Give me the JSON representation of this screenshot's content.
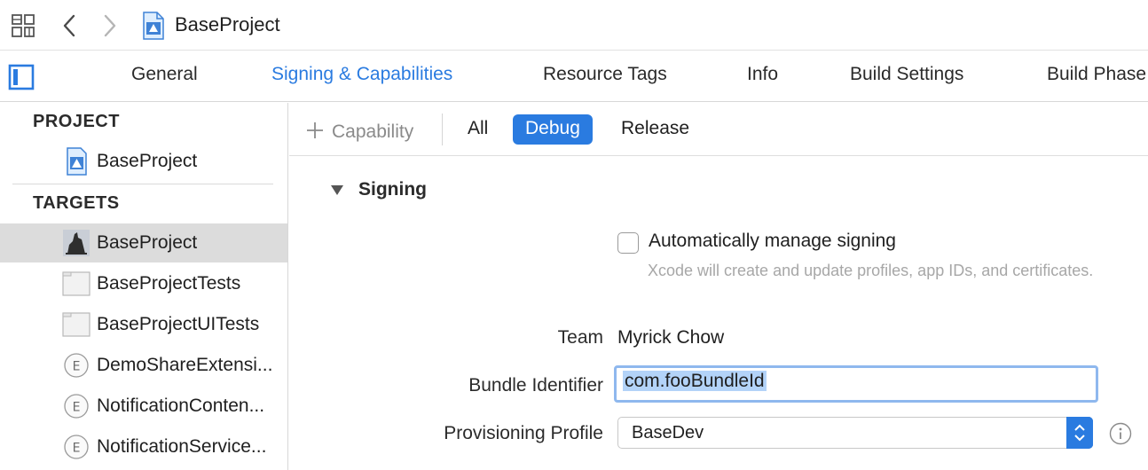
{
  "window": {
    "breadcrumb": "BaseProject"
  },
  "tabs": [
    {
      "label": "General",
      "active": false
    },
    {
      "label": "Signing & Capabilities",
      "active": true
    },
    {
      "label": "Resource Tags",
      "active": false
    },
    {
      "label": "Info",
      "active": false
    },
    {
      "label": "Build Settings",
      "active": false
    },
    {
      "label": "Build Phase",
      "active": false
    }
  ],
  "sidebar": {
    "project_header": "PROJECT",
    "project_item": "BaseProject",
    "targets_header": "TARGETS",
    "targets": [
      {
        "label": "BaseProject",
        "icon": "app-icon",
        "selected": true
      },
      {
        "label": "BaseProjectTests",
        "icon": "test-bundle-icon",
        "selected": false
      },
      {
        "label": "BaseProjectUITests",
        "icon": "test-bundle-icon",
        "selected": false
      },
      {
        "label": "DemoShareExtensi...",
        "icon": "extension-icon",
        "selected": false
      },
      {
        "label": "NotificationConten...",
        "icon": "extension-icon",
        "selected": false
      },
      {
        "label": "NotificationService...",
        "icon": "extension-icon",
        "selected": false
      }
    ]
  },
  "filterbar": {
    "add_capability": "Capability",
    "segments": [
      "All",
      "Debug",
      "Release"
    ],
    "selected_segment": "Debug"
  },
  "signing": {
    "section_title": "Signing",
    "auto_manage_label": "Automatically manage signing",
    "auto_manage_checked": false,
    "auto_manage_hint": "Xcode will create and update profiles, app IDs, and certificates.",
    "team_label": "Team",
    "team_value": "Myrick Chow",
    "bundle_label": "Bundle Identifier",
    "bundle_value": "com.fooBundleId",
    "profile_label": "Provisioning Profile",
    "profile_value": "BaseDev"
  },
  "colors": {
    "accent": "#2a7be0",
    "selection_bg": "#dcdcdc"
  }
}
